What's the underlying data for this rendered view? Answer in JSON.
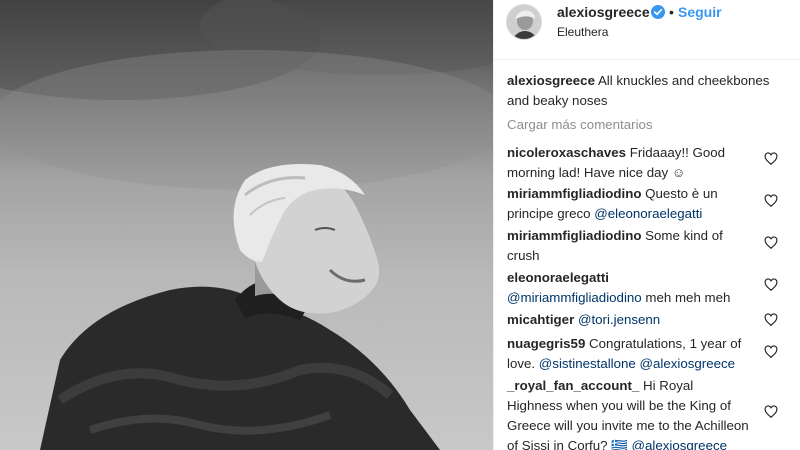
{
  "post": {
    "author": {
      "username": "alexiosgreece",
      "verified": true,
      "follow_label": "Seguir",
      "separator": "•",
      "location": "Eleuthera"
    },
    "caption": {
      "username": "alexiosgreece",
      "text": "All knuckles and cheekbones and beaky noses"
    },
    "load_more_label": "Cargar más comentarios",
    "comments": [
      {
        "username": "nicoleroxaschaves",
        "text": "Fridaaay!! Good morning lad! Have nice day ☺"
      },
      {
        "username": "miriammfigliadiodino",
        "text": "Questo è un principe greco",
        "mention": "@eleonoraelegatti"
      },
      {
        "username": "miriammfigliadiodino",
        "text": "Some kind of crush"
      },
      {
        "username": "eleonoraelegatti",
        "mention": "@miriammfigliadiodino",
        "text": "meh meh meh"
      },
      {
        "username": "micahtiger",
        "mention": "@tori.jensenn"
      },
      {
        "username": "nuagegris59",
        "text": "Congratulations, 1 year of love.",
        "mention": "@sistinestallone @alexiosgreece"
      },
      {
        "username": "_royal_fan_account_",
        "text": "Hi Royal Highness when you will be the King of Greece will you invite me to the Achilleon of Sissi in Corfu? 🇬🇷",
        "mention": "@alexiosgreece"
      }
    ]
  },
  "colors": {
    "link": "#3897f0",
    "mention": "#003569",
    "muted": "#8e8e8e",
    "text": "#262626"
  },
  "icons": {
    "verified": "verified-badge-icon",
    "like": "heart-outline-icon"
  }
}
